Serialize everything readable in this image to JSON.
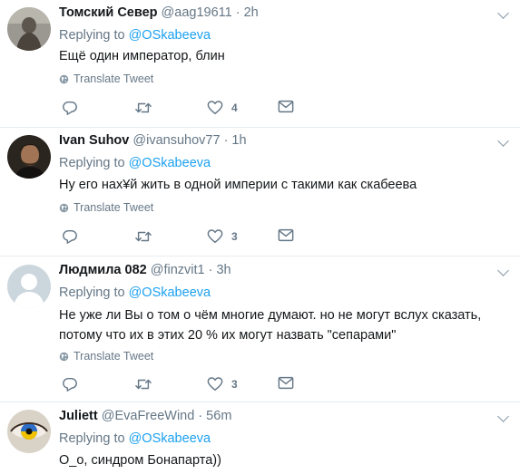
{
  "common": {
    "replying_prefix": "Replying to",
    "replying_handle": "@OSkabeeva",
    "translate_label": "Translate Tweet"
  },
  "tweets": [
    {
      "name": "Томский Север",
      "handle": "@aag19611",
      "time": "· 2h",
      "text": "Ещё один император, блин",
      "likes": "4",
      "avatar": "grey-photo"
    },
    {
      "name": "Ivan Suhov",
      "handle": "@ivansuhov77",
      "time": "· 1h",
      "text": "Ну его нах¥й жить в одной империи с такими как скабеева",
      "likes": "3",
      "avatar": "dark-photo"
    },
    {
      "name": "Людмила 082",
      "handle": "@finzvit1",
      "time": "· 3h",
      "text": "Не уже ли Вы о том о чём многие думают. но не могут вслух сказать, потому что их в этих 20 % их могут назвать \"сепарами\"",
      "likes": "3",
      "avatar": "default-silhouette"
    },
    {
      "name": "Juliett",
      "handle": "@EvaFreeWind",
      "time": "· 56m",
      "text": "О_о, синдром Бонапарта))",
      "likes": "",
      "avatar": "eye-photo"
    }
  ],
  "colors": {
    "link": "#1da1f2",
    "secondary": "#657786",
    "separator": "#e6ecf0"
  }
}
